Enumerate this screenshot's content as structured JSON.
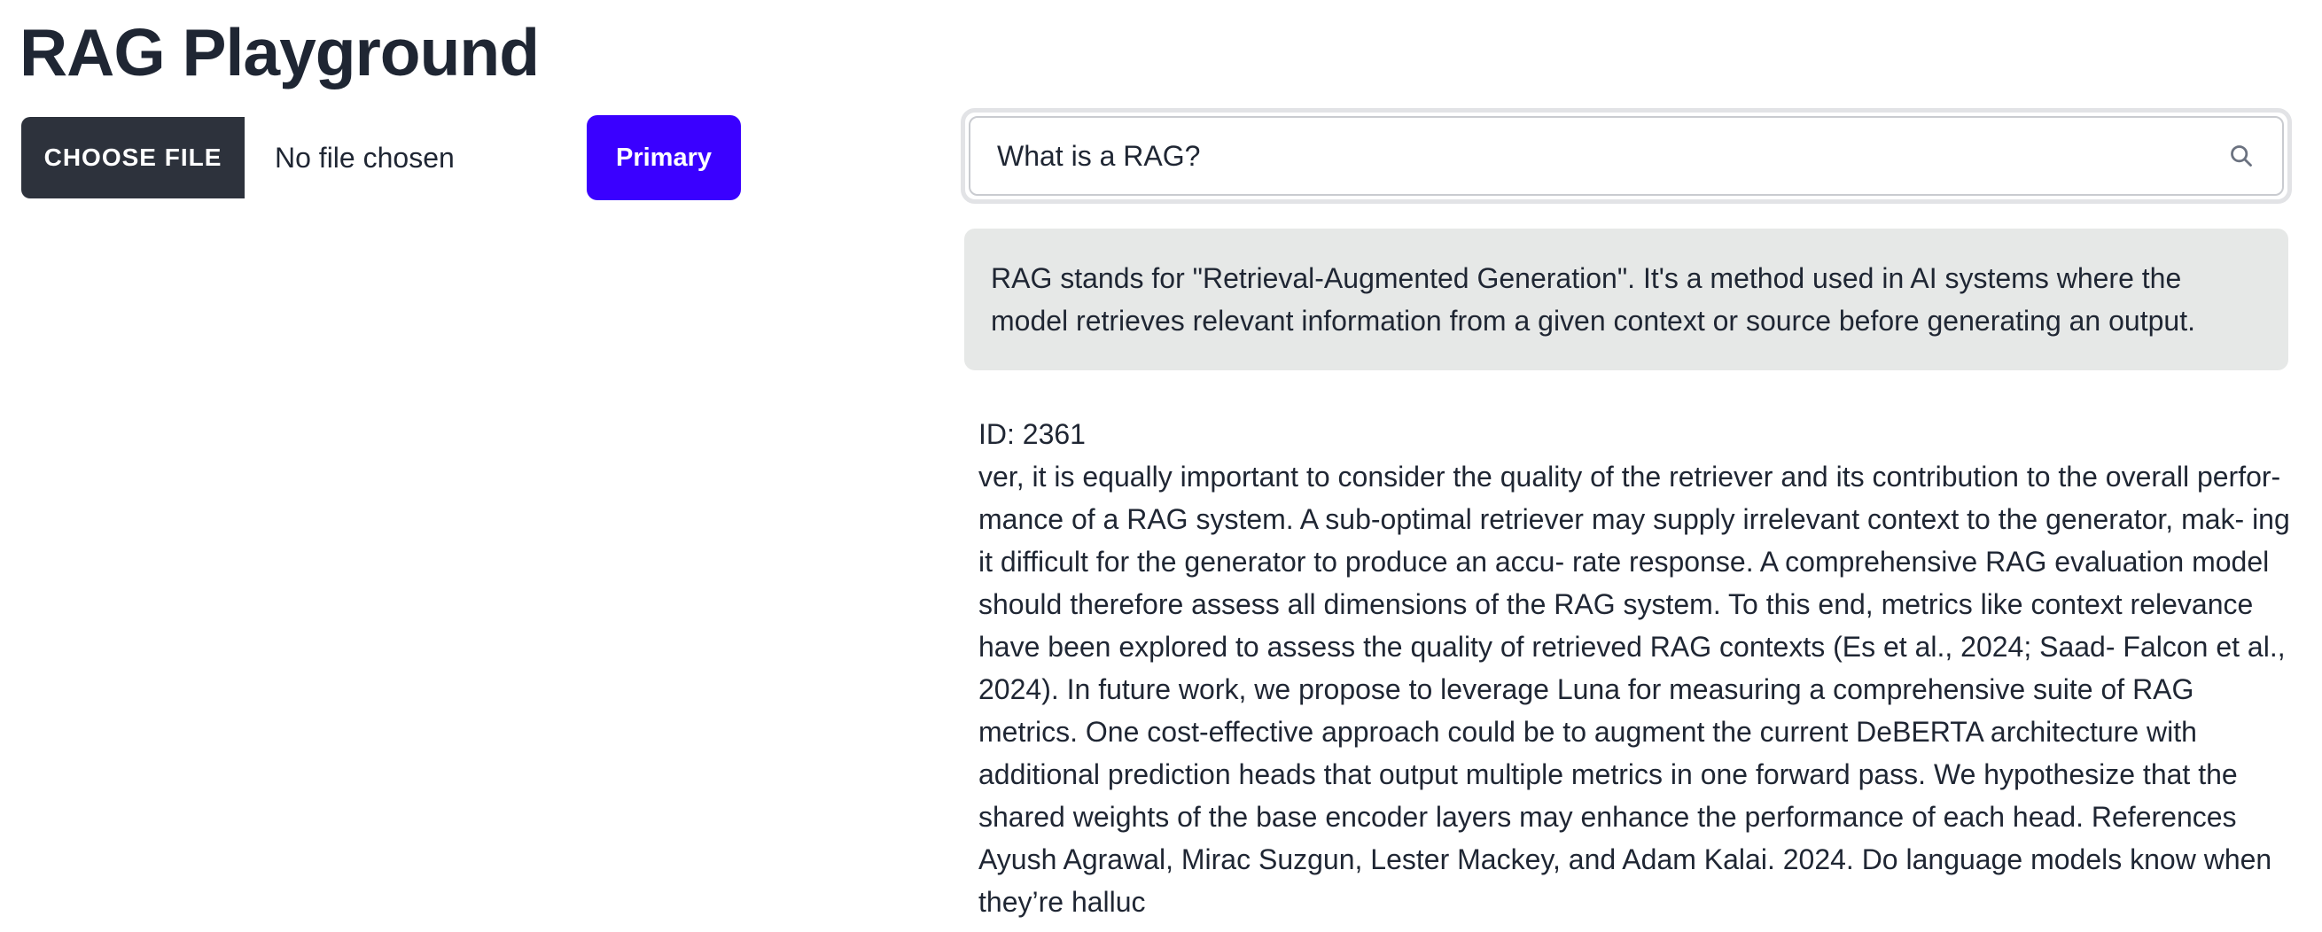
{
  "header": {
    "title": "RAG Playground"
  },
  "upload": {
    "choose_file_label": "CHOOSE FILE",
    "file_status": "No file chosen"
  },
  "primary_button": {
    "label": "Primary"
  },
  "search": {
    "value": "What is a RAG?",
    "icon": "search-icon"
  },
  "answer": {
    "text": "RAG stands for \"Retrieval-Augmented Generation\". It's a method used in AI systems where the model retrieves relevant information from a given context or source before generating an output."
  },
  "result": {
    "id_label": "ID: 2361",
    "text": "ver, it is equally important to consider the quality of the retriever and its contribution to the overall perfor- mance of a RAG system. A sub-optimal retriever may supply irrelevant context to the generator, mak- ing it difficult for the generator to produce an accu- rate response. A comprehensive RAG evaluation model should therefore assess all dimensions of the RAG system. To this end, metrics like context relevance have been explored to assess the quality of retrieved RAG contexts (Es et al., 2024; Saad- Falcon et al., 2024). In future work, we propose to leverage Luna for measuring a comprehensive suite of RAG metrics. One cost-effective approach could be to augment the current DeBERTA architecture with additional prediction heads that output multiple metrics in one forward pass. We hypothesize that the shared weights of the base encoder layers may enhance the performance of each head. References Ayush Agrawal, Mirac Suzgun, Lester Mackey, and Adam Kalai. 2024. Do language models know when they’re halluc"
  },
  "colors": {
    "primary": "#3a00ff",
    "dark_button": "#2d323c",
    "answer_background": "#e6e8e7"
  }
}
